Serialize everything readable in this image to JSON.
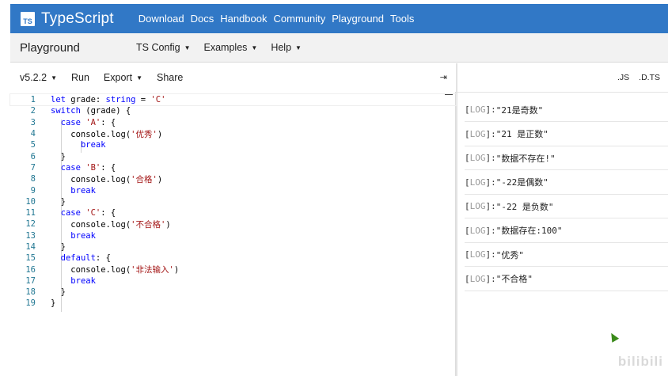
{
  "header": {
    "logo_text": "TS",
    "brand": "TypeScript",
    "nav": [
      "Download",
      "Docs",
      "Handbook",
      "Community",
      "Playground",
      "Tools"
    ]
  },
  "subbar": {
    "title": "Playground",
    "menus": [
      "TS Config",
      "Examples",
      "Help"
    ]
  },
  "toolbar": {
    "version": "v5.2.2",
    "run": "Run",
    "export": "Export",
    "share": "Share",
    "collapse_icon": "⇥"
  },
  "editor": {
    "lines": [
      {
        "n": "1",
        "code": "let grade: string = 'C'"
      },
      {
        "n": "2",
        "code": "switch (grade) {"
      },
      {
        "n": "3",
        "code": "  case 'A': {"
      },
      {
        "n": "4",
        "code": "    console.log('优秀')"
      },
      {
        "n": "5",
        "code": "      break"
      },
      {
        "n": "6",
        "code": "  }"
      },
      {
        "n": "7",
        "code": "  case 'B': {"
      },
      {
        "n": "8",
        "code": "    console.log('合格')"
      },
      {
        "n": "9",
        "code": "    break"
      },
      {
        "n": "10",
        "code": "  }"
      },
      {
        "n": "11",
        "code": "  case 'C': {"
      },
      {
        "n": "12",
        "code": "    console.log('不合格')"
      },
      {
        "n": "13",
        "code": "    break"
      },
      {
        "n": "14",
        "code": "  }"
      },
      {
        "n": "15",
        "code": "  default: {"
      },
      {
        "n": "16",
        "code": "    console.log('非法输入')"
      },
      {
        "n": "17",
        "code": "    break"
      },
      {
        "n": "18",
        "code": "  }"
      },
      {
        "n": "19",
        "code": "}"
      }
    ]
  },
  "output": {
    "tabs": [
      ".JS",
      ".D.TS"
    ],
    "log_tag": "LOG",
    "logs": [
      "\"21是奇数\"",
      "\"21 是正数\"",
      "\"数据不存在!\"",
      "\"-22是偶数\"",
      "\"-22 是负数\"",
      "\"数据存在:100\"",
      "\"优秀\"",
      "\"不合格\""
    ]
  },
  "watermark": "bilibili",
  "colors": {
    "brand": "#3178c6",
    "keyword": "#0000ff",
    "string": "#a31515",
    "line_number": "#237893"
  }
}
